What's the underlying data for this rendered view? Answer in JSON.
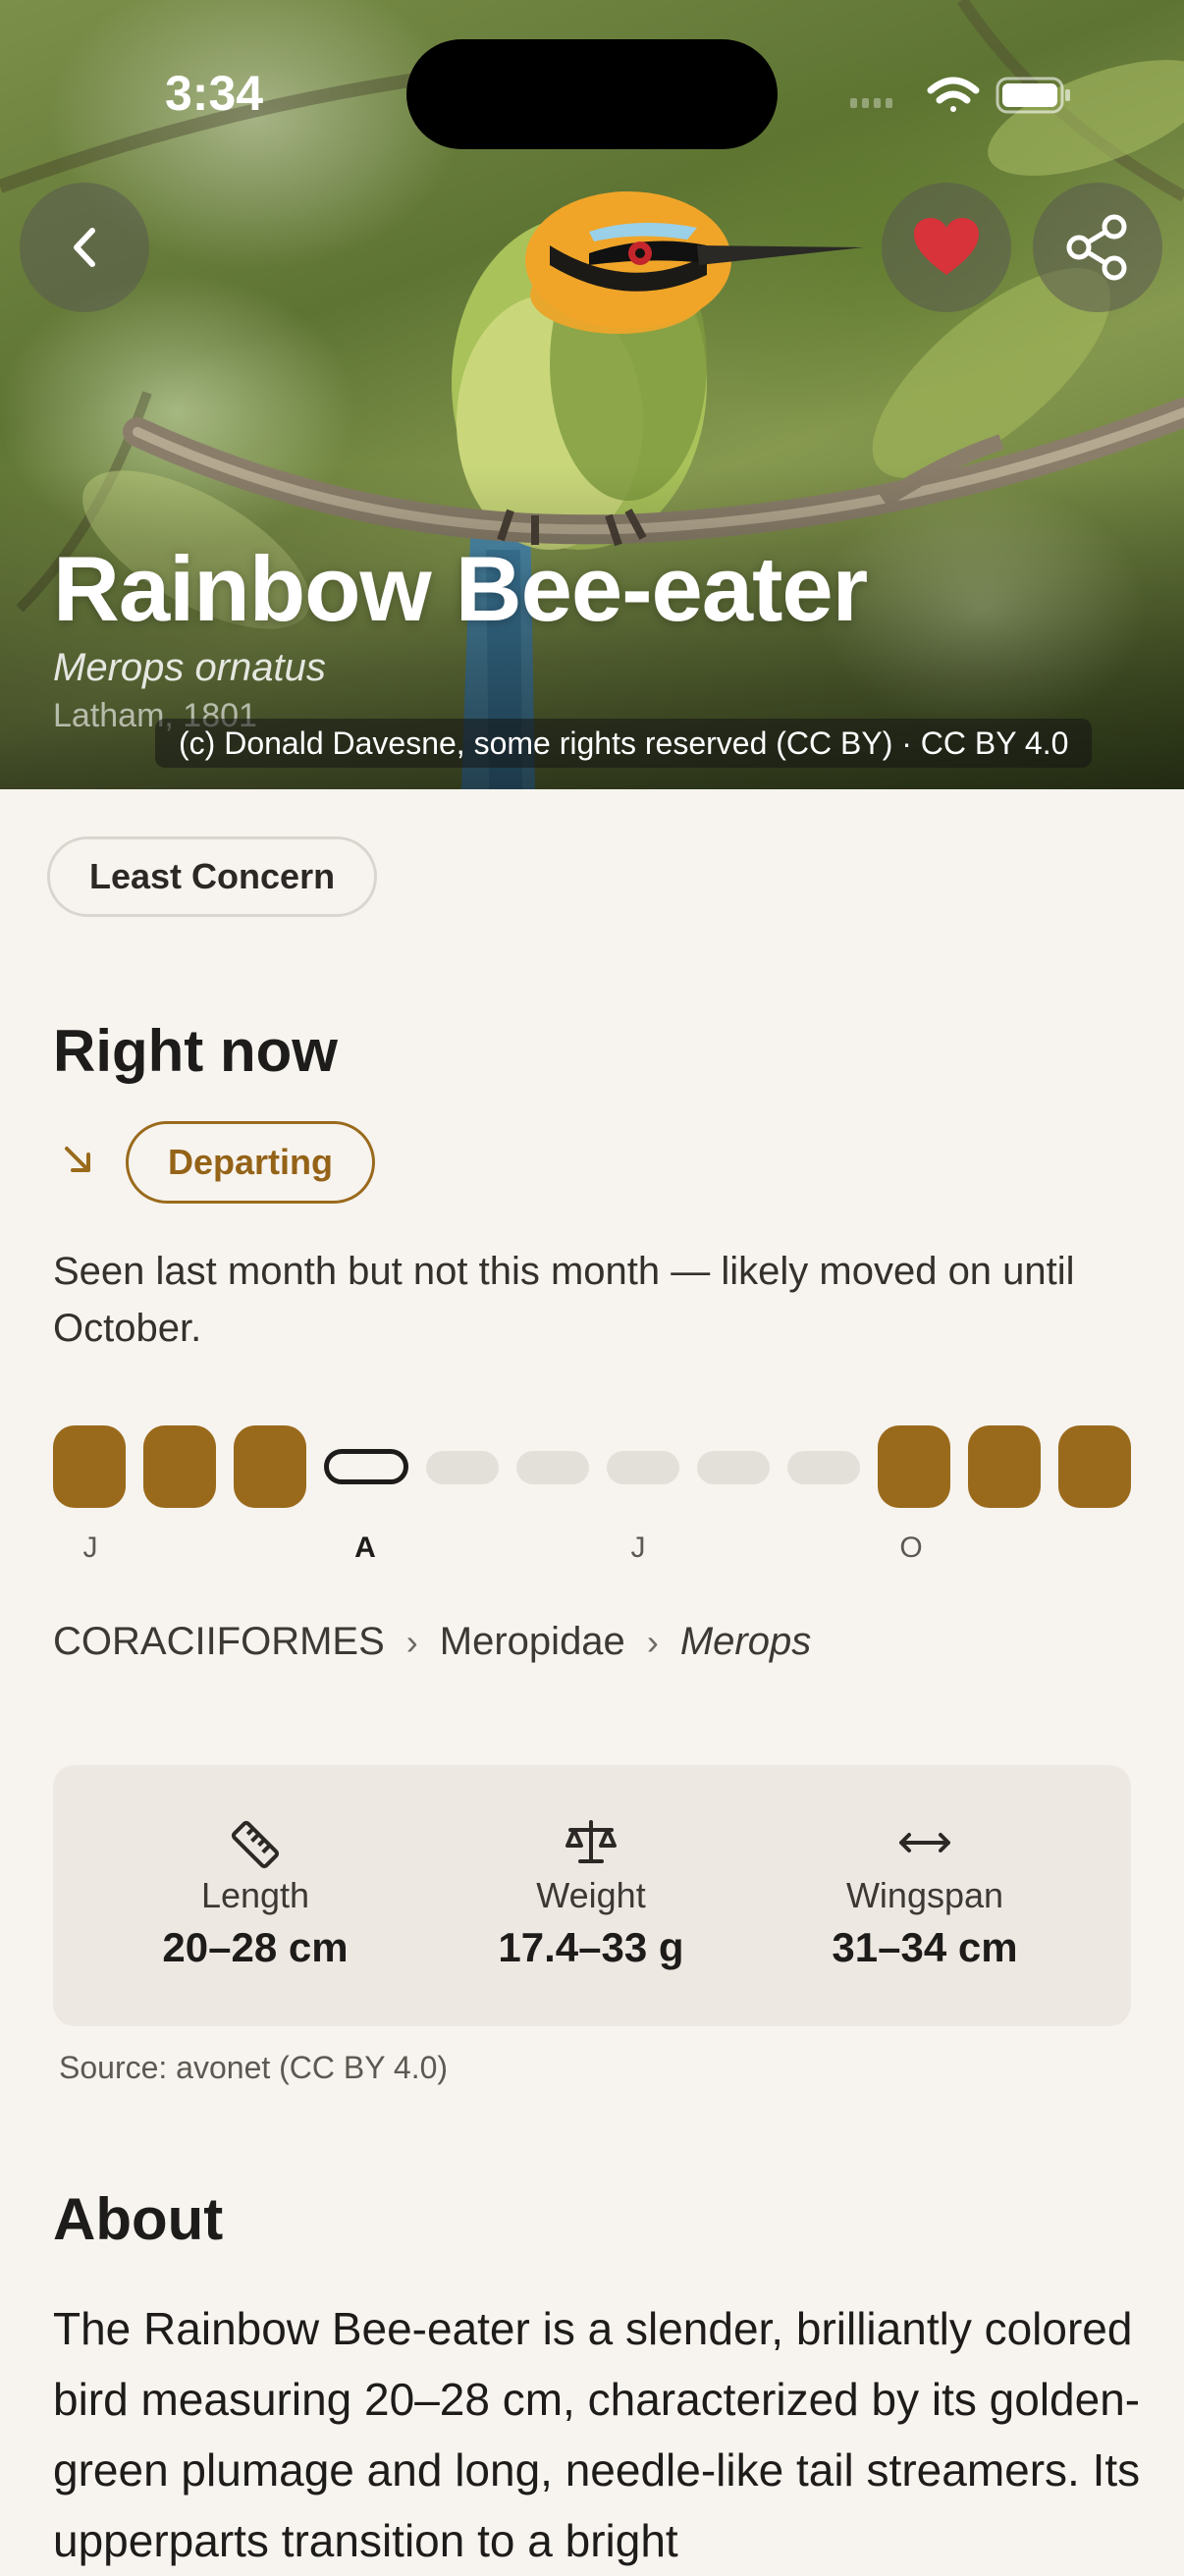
{
  "status_bar": {
    "time": "3:34"
  },
  "hero": {
    "title": "Rainbow Bee-eater",
    "scientific_name": "Merops ornatus",
    "authority": "Latham, 1801",
    "photo_credit": "(c) Donald Davesne, some rights reserved (CC BY) · CC BY 4.0",
    "favorite_color": "#D8333A"
  },
  "conservation_status": "Least Concern",
  "right_now": {
    "heading": "Right now",
    "status": "Departing",
    "description": "Seen last month but not this month — likely moved on until October.",
    "accent_color": "#9A6A1C",
    "month_labels": [
      "J",
      "A",
      "J",
      "O"
    ],
    "current_month_label": "A"
  },
  "taxonomy": {
    "order": "CORACIIFORMES",
    "family": "Meropidae",
    "genus": "Merops",
    "separator": "›"
  },
  "measurements": {
    "items": [
      {
        "icon": "ruler-icon",
        "label": "Length",
        "value": "20–28 cm"
      },
      {
        "icon": "scale-icon",
        "label": "Weight",
        "value": "17.4–33 g"
      },
      {
        "icon": "wingspan-icon",
        "label": "Wingspan",
        "value": "31–34 cm"
      }
    ],
    "source": "Source: avonet (CC BY 4.0)"
  },
  "about": {
    "heading": "About",
    "text": "The Rainbow Bee-eater is a slender, brilliantly colored bird measuring 20–28 cm, characterized by its golden-green plumage and long, needle-like tail streamers. Its upperparts transition to a bright"
  }
}
